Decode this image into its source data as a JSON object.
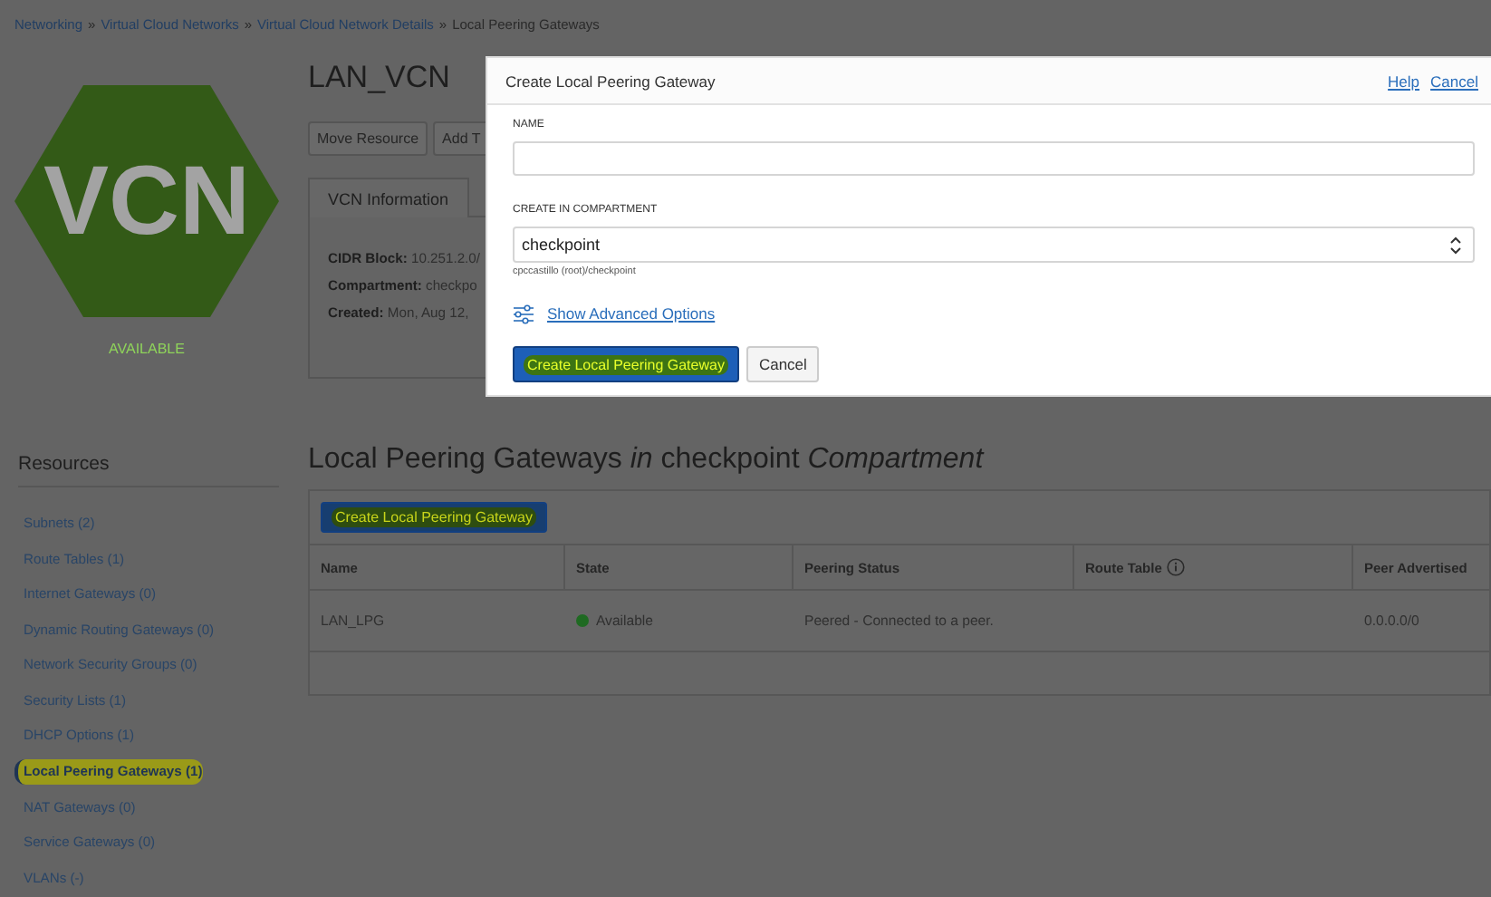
{
  "breadcrumb": [
    {
      "kind": "link",
      "label": "Networking"
    },
    {
      "kind": "separator",
      "label": "»"
    },
    {
      "kind": "link",
      "label": "Virtual Cloud Networks"
    },
    {
      "kind": "separator",
      "label": "»"
    },
    {
      "kind": "link",
      "label": "Virtual Cloud Network Details"
    },
    {
      "kind": "separator",
      "label": "»"
    },
    {
      "kind": "current",
      "label": "Local Peering Gateways"
    }
  ],
  "resource": {
    "logo_text": "VCN",
    "status": "AVAILABLE",
    "title": "LAN_VCN",
    "actions": [
      "Move Resource",
      "Add T"
    ],
    "tab": "VCN Information",
    "details": [
      {
        "label": "CIDR Block:",
        "value": "10.251.2.0/"
      },
      {
        "label": "Compartment:",
        "value": "checkpo"
      },
      {
        "label": "Created:",
        "value": "Mon, Aug 12,"
      }
    ]
  },
  "resources": {
    "title": "Resources",
    "items": [
      {
        "label": "Subnets (2)",
        "selected": false,
        "highlighted": false
      },
      {
        "label": "Route Tables (1)",
        "selected": false,
        "highlighted": false
      },
      {
        "label": "Internet Gateways (0)",
        "selected": false,
        "highlighted": false
      },
      {
        "label": "Dynamic Routing Gateways (0)",
        "selected": false,
        "highlighted": false
      },
      {
        "label": "Network Security Groups (0)",
        "selected": false,
        "highlighted": false
      },
      {
        "label": "Security Lists (1)",
        "selected": false,
        "highlighted": false
      },
      {
        "label": "DHCP Options (1)",
        "selected": false,
        "highlighted": false
      },
      {
        "label": "Local Peering Gateways (1)",
        "selected": true,
        "highlighted": true
      },
      {
        "label": "NAT Gateways (0)",
        "selected": false,
        "highlighted": false
      },
      {
        "label": "Service Gateways (0)",
        "selected": false,
        "highlighted": false
      },
      {
        "label": "VLANs (-)",
        "selected": false,
        "highlighted": false
      }
    ]
  },
  "section": {
    "title": "Local Peering Gateways *in* checkpoint *Compartment*",
    "create_button": {
      "label": "Create Local Peering Gateway",
      "highlighted": true
    },
    "table": {
      "columns": [
        {
          "label": "Name",
          "info": false
        },
        {
          "label": "State",
          "info": false
        },
        {
          "label": "Peering Status",
          "info": false
        },
        {
          "label": "Route Table",
          "info": true
        },
        {
          "label": "Peer Advertised",
          "info": false
        }
      ],
      "rows": [
        {
          "name": "LAN_LPG",
          "state": "Available",
          "color": "#1f6a22",
          "peering_status": "Peered - Connected to a peer.",
          "peer_advertised": "0.0.0.0/0"
        }
      ]
    }
  },
  "dialog": {
    "title": "Create Local Peering Gateway",
    "links": [
      "Help",
      "Cancel"
    ],
    "fields": [
      {
        "kind": "text",
        "label": "NAME"
      },
      {
        "kind": "select",
        "label": "CREATE IN COMPARTMENT",
        "value": "checkpoint",
        "hint": "cpccastillo (root)/checkpoint"
      }
    ],
    "advanced_link": "Show Advanced Options",
    "buttons": [
      {
        "kind": "primary",
        "label": "Create Local Peering Gateway",
        "highlighted": true
      },
      {
        "kind": "secondary",
        "label": "Cancel",
        "highlighted": false
      }
    ]
  }
}
